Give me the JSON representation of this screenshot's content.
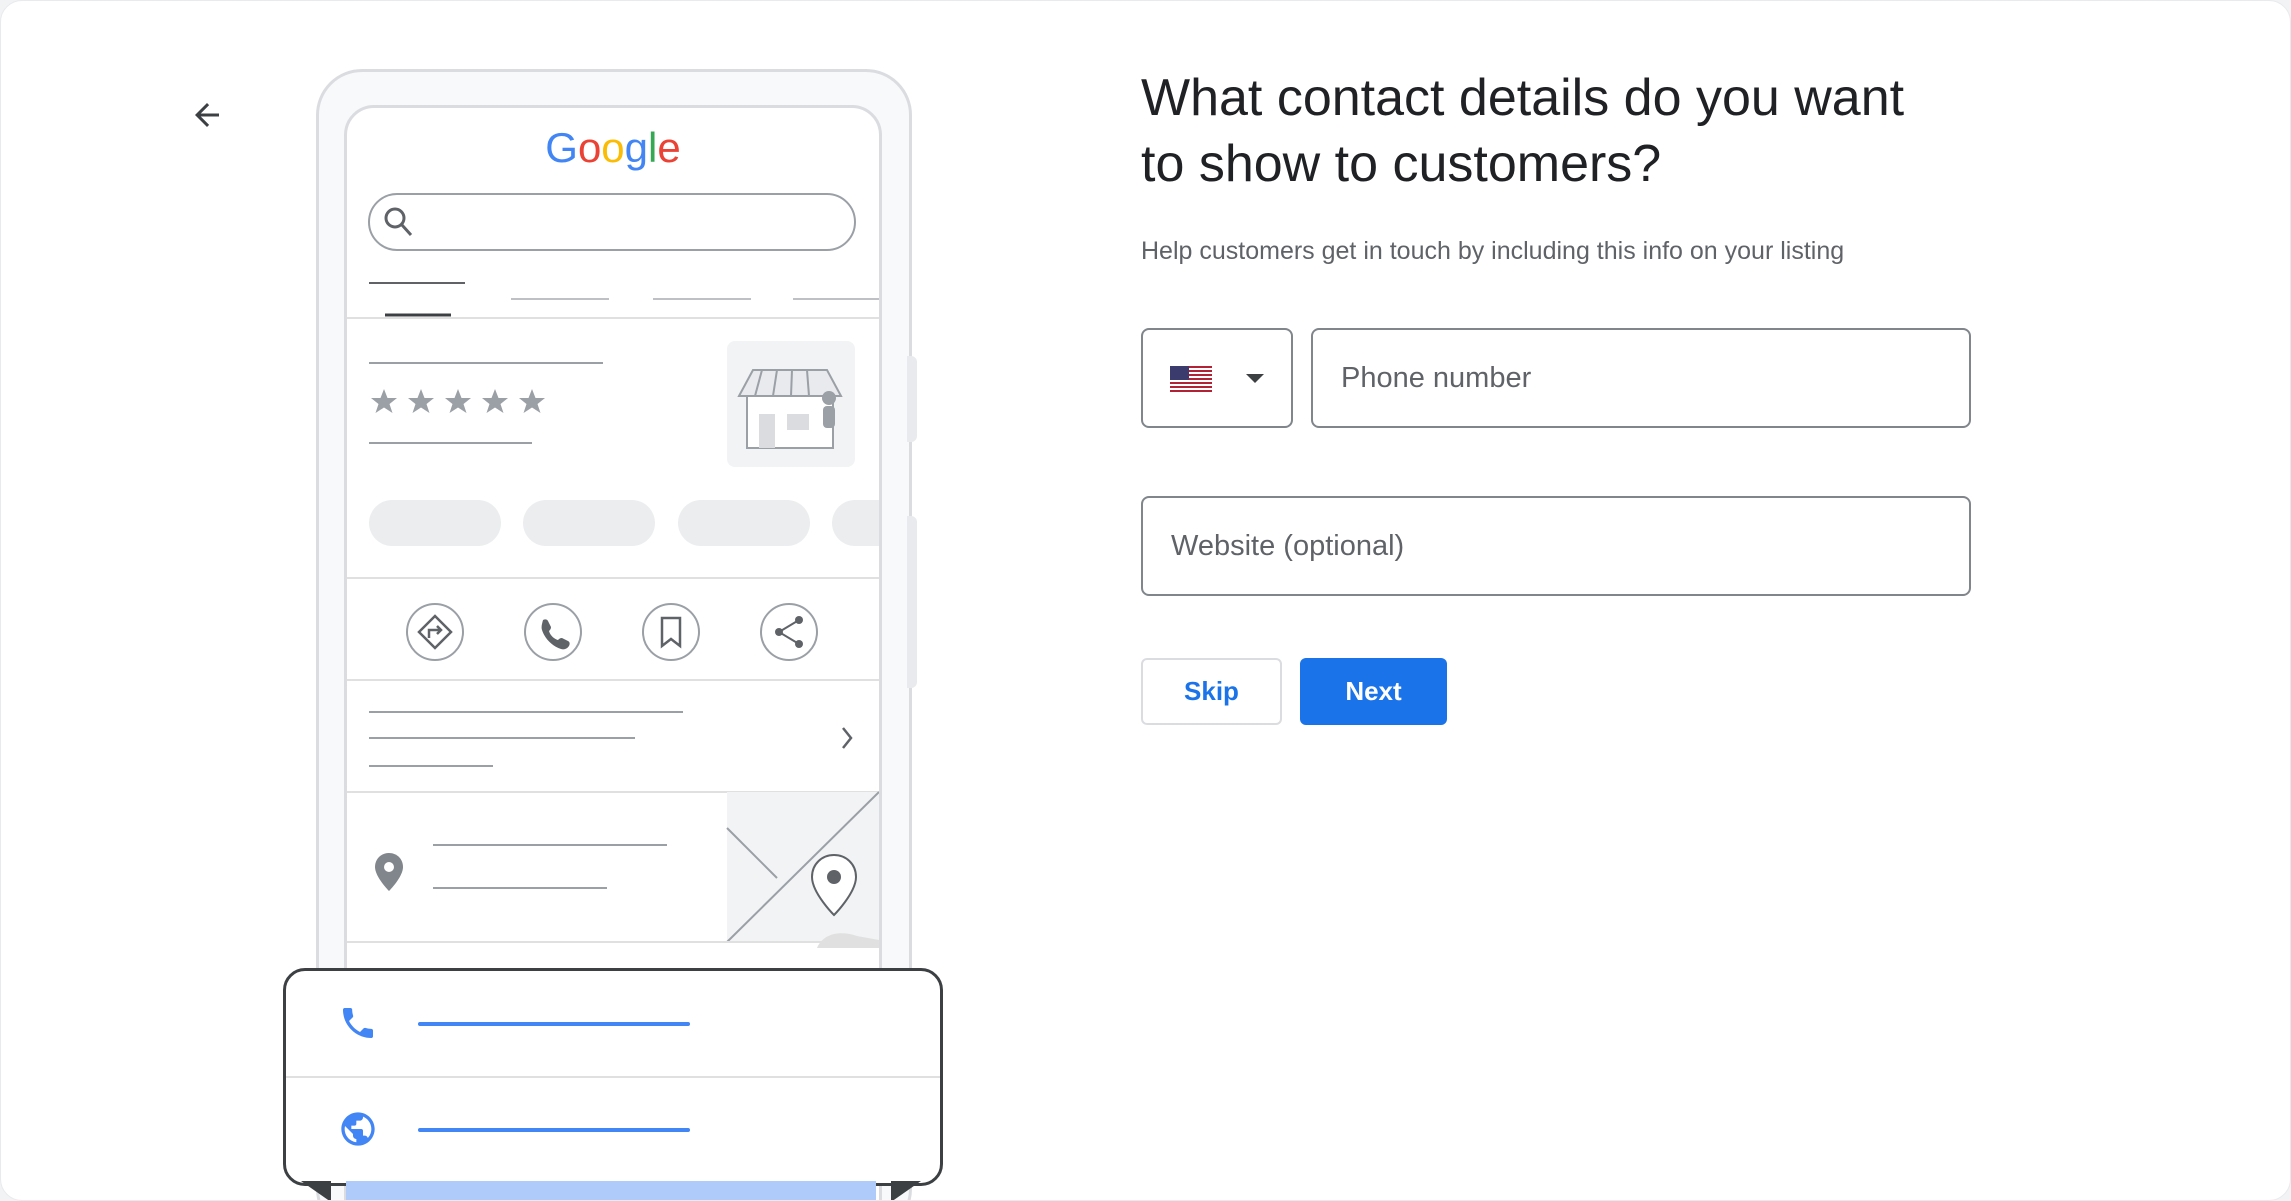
{
  "header": {
    "back_icon": "arrow-back-icon",
    "title": "What contact details do you want to show to customers?",
    "title_line1": "What contact details do you want",
    "title_line2": "to show to customers?",
    "subtitle": "Help customers get in touch by including this info on your listing"
  },
  "illustration": {
    "logo_text": "Google",
    "logo_colors": [
      "#4285F4",
      "#EA4335",
      "#FBBC05",
      "#4285F4",
      "#34A853",
      "#EA4335"
    ],
    "rating_stars": 5,
    "action_icons": [
      "directions-icon",
      "phone-icon",
      "bookmark-icon",
      "share-icon"
    ],
    "card_icons": [
      "phone-icon",
      "globe-icon"
    ],
    "accent_color": "#4285F4"
  },
  "form": {
    "country_flag": "us-flag-icon",
    "phone": {
      "placeholder": "Phone number",
      "value": ""
    },
    "website": {
      "placeholder": "Website (optional)",
      "value": ""
    }
  },
  "actions": {
    "skip_label": "Skip",
    "next_label": "Next",
    "primary_color": "#1A73E8"
  }
}
